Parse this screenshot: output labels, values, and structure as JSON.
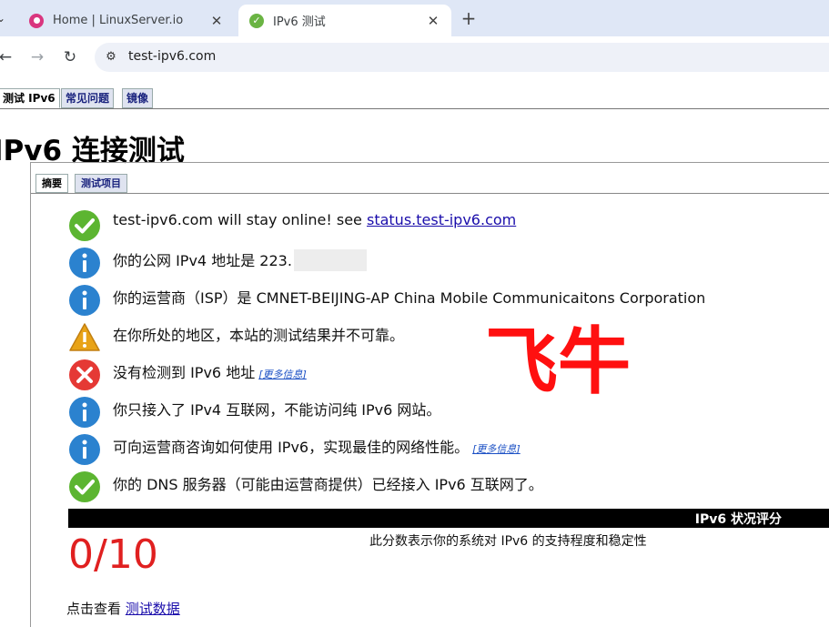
{
  "browser": {
    "tabs": [
      {
        "title": "Home | LinuxServer.io",
        "active": false,
        "icon": "linuxserver-favicon-icon"
      },
      {
        "title": "IPv6 测试",
        "active": true,
        "icon": "checkmark-favicon-icon"
      }
    ],
    "close_glyph": "✕",
    "new_tab_glyph": "+",
    "url": "test-ipv6.com"
  },
  "page": {
    "nav_tabs": [
      "测试 IPv6",
      "常见问题",
      "镜像"
    ],
    "heading": "IPv6 连接测试",
    "sub_tabs": [
      "摘要",
      "测试项目"
    ],
    "results": [
      {
        "icon": "check",
        "text": "test-ipv6.com will stay online! see ",
        "link": "status.test-ipv6.com"
      },
      {
        "icon": "info",
        "text": "你的公网 IPv4 地址是 223.",
        "redacted": true
      },
      {
        "icon": "info",
        "text": "你的运营商（ISP）是 CMNET-BEIJING-AP China Mobile Communicaitons Corporation"
      },
      {
        "icon": "warning",
        "text": "在你所处的地区，本站的测试结果并不可靠。"
      },
      {
        "icon": "error",
        "text": "没有检测到 IPv6 地址",
        "more": "[更多信息]"
      },
      {
        "icon": "info",
        "text": "你只接入了 IPv4 互联网，不能访问纯 IPv6 网站。"
      },
      {
        "icon": "info",
        "text": "可向运营商咨询如何使用 IPv6，实现最佳的网络性能。",
        "more": "[更多信息]"
      },
      {
        "icon": "check",
        "text": "你的 DNS 服务器（可能由运营商提供）已经接入 IPv6 互联网了。"
      }
    ],
    "watermark": "飞牛",
    "score_title": "IPv6 状况评分",
    "score": "0/10",
    "score_description": "此分数表示你的系统对 IPv6 的支持程度和稳定性",
    "footer_text": "点击查看 ",
    "footer_link": "测试数据"
  },
  "colors": {
    "check": "#5cb531",
    "info": "#2b82cf",
    "warning": "#e8a317",
    "error": "#e53935",
    "score": "#e02020"
  }
}
